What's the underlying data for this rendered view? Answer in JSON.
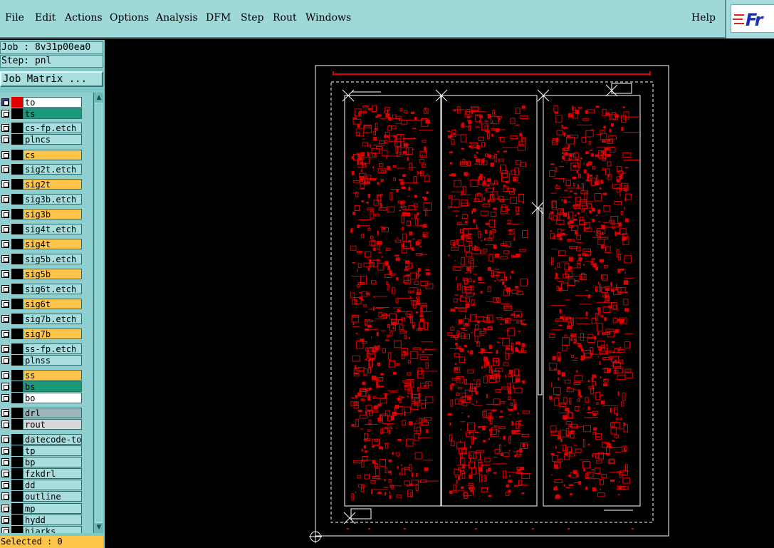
{
  "menu": {
    "file": "File",
    "edit": "Edit",
    "actions": "Actions",
    "options": "Options",
    "analysis": "Analysis",
    "dfm": "DFM",
    "step": "Step",
    "rout": "Rout",
    "windows": "Windows",
    "help": "Help"
  },
  "logo_text": "Fr",
  "job_line": "Job : 8v31p00ea0",
  "step_line": "Step: pnl",
  "job_matrix_label": "Job Matrix ...",
  "layers": [
    {
      "name": "to",
      "color": "#ffffff",
      "top_marker": true
    },
    {
      "name": "ts",
      "color": "#1a9a78"
    },
    {
      "name": "cs-fp.etch",
      "color": "#a8dede"
    },
    {
      "name": "plncs",
      "color": "#a8dede"
    },
    {
      "name": "cs",
      "color": "#ffc54a"
    },
    {
      "name": "sig2t.etch",
      "color": "#a8dede"
    },
    {
      "name": "sig2t",
      "color": "#ffc54a"
    },
    {
      "name": "sig3b.etch",
      "color": "#a8dede"
    },
    {
      "name": "sig3b",
      "color": "#ffc54a"
    },
    {
      "name": "sig4t.etch",
      "color": "#a8dede"
    },
    {
      "name": "sig4t",
      "color": "#ffc54a"
    },
    {
      "name": "sig5b.etch",
      "color": "#a8dede"
    },
    {
      "name": "sig5b",
      "color": "#ffc54a"
    },
    {
      "name": "sig6t.etch",
      "color": "#a8dede"
    },
    {
      "name": "sig6t",
      "color": "#ffc54a"
    },
    {
      "name": "sig7b.etch",
      "color": "#a8dede"
    },
    {
      "name": "sig7b",
      "color": "#ffc54a"
    },
    {
      "name": "ss-fp.etch",
      "color": "#a8dede"
    },
    {
      "name": "plnss",
      "color": "#a8dede"
    },
    {
      "name": "ss",
      "color": "#ffc54a"
    },
    {
      "name": "bs",
      "color": "#1a9a78"
    },
    {
      "name": "bo",
      "color": "#ffffff"
    },
    {
      "name": "drl",
      "color": "#9bb5b8"
    },
    {
      "name": "rout",
      "color": "#d8d8d8"
    },
    {
      "name": "datecode-to",
      "color": "#a8dede"
    },
    {
      "name": "tp",
      "color": "#a8dede"
    },
    {
      "name": "bp",
      "color": "#a8dede"
    },
    {
      "name": "fzkdrl",
      "color": "#a8dede"
    },
    {
      "name": "dd",
      "color": "#a8dede"
    },
    {
      "name": "outline",
      "color": "#a8dede"
    },
    {
      "name": "mp",
      "color": "#a8dede"
    },
    {
      "name": "hydd",
      "color": "#a8dede"
    },
    {
      "name": "hiarks",
      "color": "#a8dede"
    }
  ],
  "selected_text": "Selected : 0",
  "colors": {
    "panel": "#9fd8d8",
    "trace": "#e00000",
    "outline": "#ffffff",
    "highlight_layer": "#ffc54a"
  },
  "icons": {
    "scroll_up": "▲",
    "scroll_down": "▼"
  }
}
